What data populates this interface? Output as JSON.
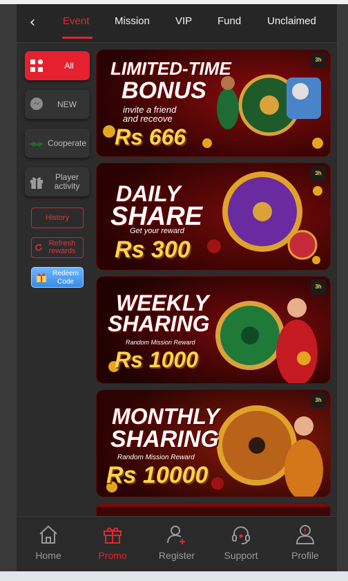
{
  "header": {
    "back_icon": "chevron-left-icon",
    "tabs": [
      {
        "label": "Event",
        "active": true
      },
      {
        "label": "Mission",
        "active": false
      },
      {
        "label": "VIP",
        "active": false
      },
      {
        "label": "Fund",
        "active": false
      },
      {
        "label": "Unclaimed",
        "active": false
      }
    ]
  },
  "sidebar": {
    "items": [
      {
        "label": "All",
        "icon": "grid-icon",
        "active": true
      },
      {
        "label": "NEW",
        "icon": "chat-bubble-icon",
        "active": false
      },
      {
        "label": "Cooperate",
        "icon": "handshake-icon",
        "active": false
      },
      {
        "label": "Player activity",
        "icon": "gift-icon",
        "active": false
      }
    ],
    "history_label": "History",
    "refresh_label": "Refresh rewards",
    "redeem_label": "Redeem Code"
  },
  "banners": [
    {
      "title_1": "LIMITED-TIME",
      "title_2": "BONUS",
      "subtitle": "invite a friend and receove",
      "amount": "Rs 666"
    },
    {
      "title_1": "DAILY",
      "title_2": "SHARE",
      "subtitle": "Get your reward",
      "amount": "Rs 300"
    },
    {
      "title_1": "WEEKLY",
      "title_2": "SHARING",
      "subtitle": "Random Mission Reward",
      "amount": "Rs 1000"
    },
    {
      "title_1": "MONTHLY",
      "title_2": "SHARING",
      "subtitle": "Random Mission Reward",
      "amount": "Rs 10000"
    }
  ],
  "bottom_nav": [
    {
      "label": "Home",
      "icon": "home-icon",
      "active": false
    },
    {
      "label": "Promo",
      "icon": "gift-icon",
      "active": true
    },
    {
      "label": "Register",
      "icon": "user-add-icon",
      "active": false
    },
    {
      "label": "Support",
      "icon": "headset-icon",
      "active": false
    },
    {
      "label": "Profile",
      "icon": "user-alert-icon",
      "active": false
    }
  ],
  "colors": {
    "accent": "#e8232f",
    "background": "#2c2c2c"
  }
}
